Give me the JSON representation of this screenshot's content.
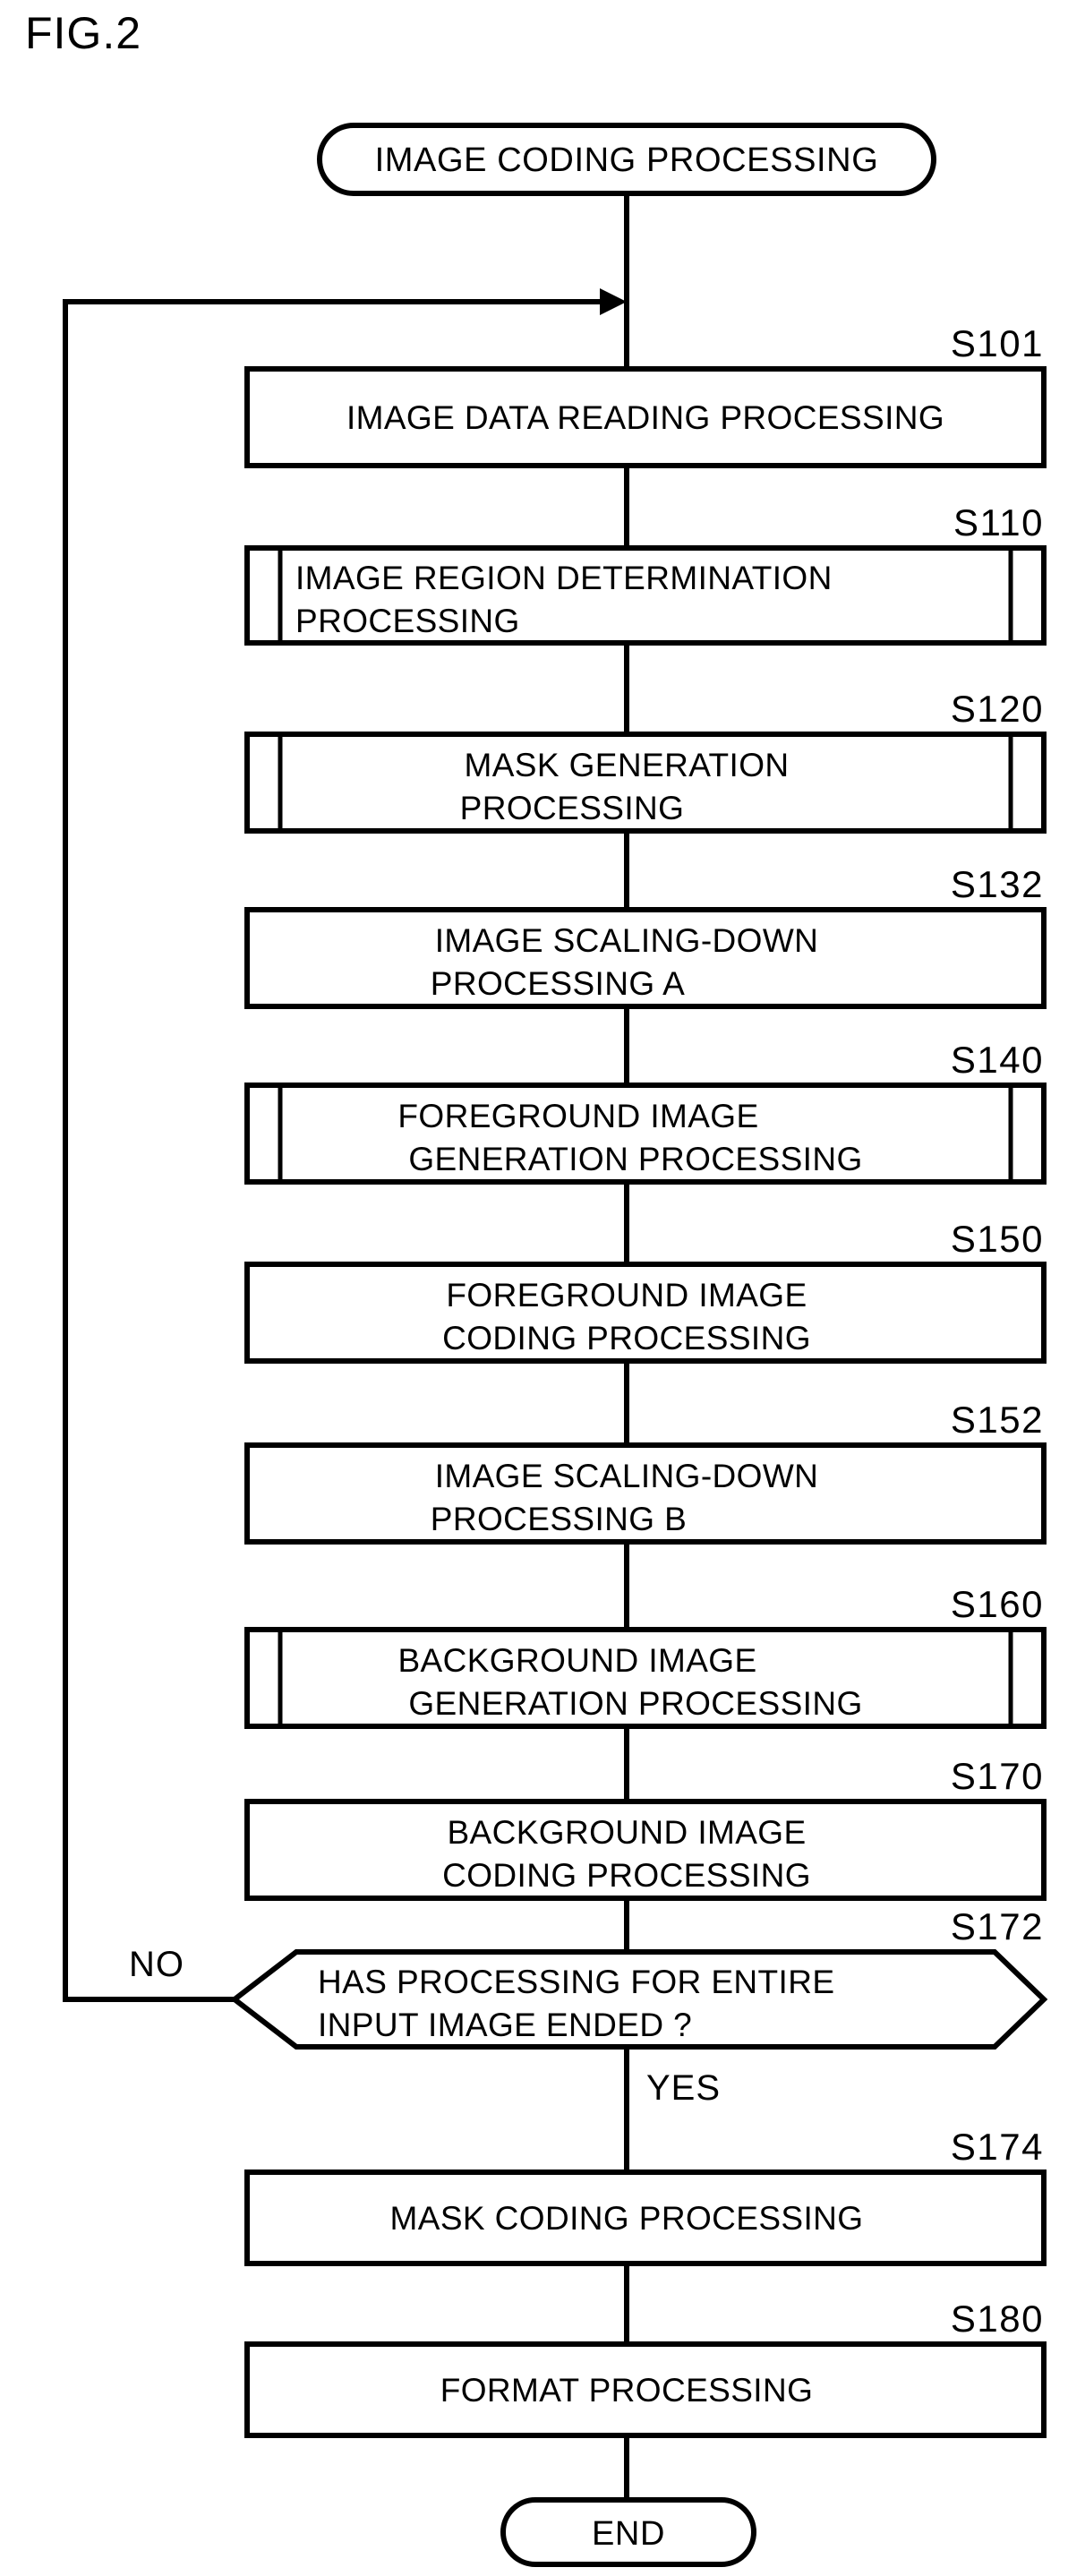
{
  "figure": {
    "label": "FIG.2",
    "title_terminator": "IMAGE CODING PROCESSING",
    "end_terminator": "END"
  },
  "branches": {
    "no_label": "NO",
    "yes_label": "YES"
  },
  "steps": [
    {
      "id": "S101",
      "shape": "process",
      "align": "center",
      "lines": [
        "IMAGE DATA READING PROCESSING"
      ]
    },
    {
      "id": "S110",
      "shape": "predefined-process",
      "align": "left",
      "lines": [
        "IMAGE REGION DETERMINATION",
        "PROCESSING"
      ]
    },
    {
      "id": "S120",
      "shape": "predefined-process",
      "align": "center",
      "lines": [
        "MASK GENERATION",
        "PROCESSING"
      ]
    },
    {
      "id": "S132",
      "shape": "process",
      "align": "center",
      "lines": [
        "IMAGE SCALING-DOWN",
        "PROCESSING A"
      ]
    },
    {
      "id": "S140",
      "shape": "predefined-process",
      "align": "center",
      "lines": [
        "FOREGROUND IMAGE",
        "GENERATION PROCESSING"
      ]
    },
    {
      "id": "S150",
      "shape": "process",
      "align": "center",
      "lines": [
        "FOREGROUND IMAGE",
        "CODING PROCESSING"
      ]
    },
    {
      "id": "S152",
      "shape": "process",
      "align": "center",
      "lines": [
        "IMAGE SCALING-DOWN",
        "PROCESSING B"
      ]
    },
    {
      "id": "S160",
      "shape": "predefined-process",
      "align": "center",
      "lines": [
        "BACKGROUND IMAGE",
        "GENERATION PROCESSING"
      ]
    },
    {
      "id": "S170",
      "shape": "process",
      "align": "center",
      "lines": [
        "BACKGROUND IMAGE",
        "CODING PROCESSING"
      ]
    },
    {
      "id": "S172",
      "shape": "decision",
      "align": "left",
      "lines": [
        "HAS PROCESSING FOR ENTIRE",
        "INPUT IMAGE ENDED ?"
      ]
    },
    {
      "id": "S174",
      "shape": "process",
      "align": "center",
      "lines": [
        "MASK CODING PROCESSING"
      ]
    },
    {
      "id": "S180",
      "shape": "process",
      "align": "center",
      "lines": [
        "FORMAT PROCESSING"
      ]
    }
  ],
  "colors": {
    "ink": "#000000",
    "paper": "#ffffff"
  }
}
